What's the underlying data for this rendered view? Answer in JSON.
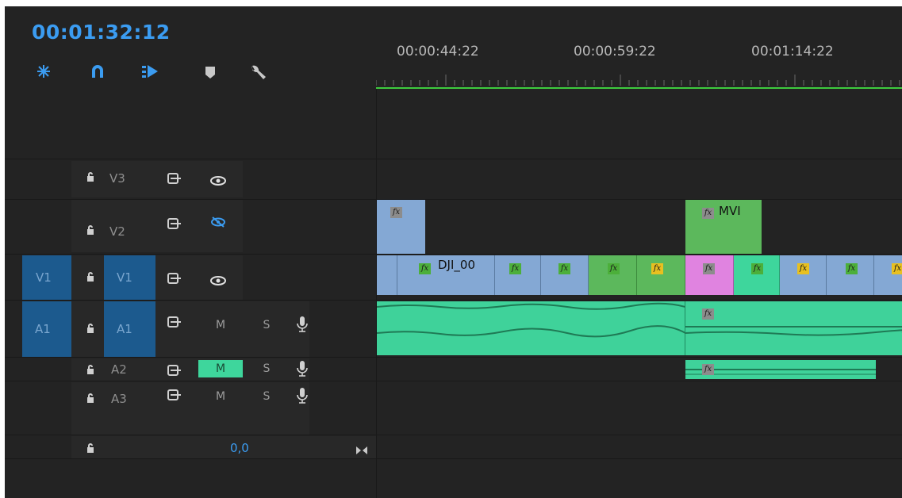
{
  "timeline": {
    "current_time": "00:01:32:12",
    "ruler_times": [
      "00:00:44:22",
      "00:00:59:22",
      "00:01:14:22"
    ],
    "audio_volume": "0,0"
  },
  "toolbar": [
    {
      "icon": "snap-sequence-icon",
      "color": "#3b9cf1"
    },
    {
      "icon": "magnet-linked-selection-icon",
      "color": "#3b9cf1"
    },
    {
      "icon": "insert-overwrite-icon",
      "color": "#3b9cf1"
    },
    {
      "icon": "add-marker-icon",
      "color": "#c8c8c8"
    },
    {
      "icon": "wrench-settings-icon",
      "color": "#c8c8c8"
    }
  ],
  "tracks": {
    "v3": {
      "name": "V3"
    },
    "v2": {
      "name": "V2"
    },
    "v1": {
      "name": "V1",
      "source": "V1"
    },
    "a1": {
      "name": "A1",
      "source": "A1",
      "mute": "M",
      "solo": "S"
    },
    "a2": {
      "name": "A2",
      "mute": "M",
      "solo": "S"
    },
    "a3": {
      "name": "A3",
      "mute": "M",
      "solo": "S"
    }
  },
  "clips": {
    "v2_right_name": "MVI",
    "v1_main_name": "DJI_00",
    "fx_label": "fx"
  },
  "colors": {
    "accent_blue": "#3b9cf1",
    "track_target": "#1c5a8e",
    "video_clip": "#84a8d4",
    "green_clip": "#5cb85c",
    "pink_clip": "#e083e0",
    "teal_clip": "#3ed69c",
    "audio_clip": "#3fd29a",
    "mute_active": "#3ed69c"
  }
}
